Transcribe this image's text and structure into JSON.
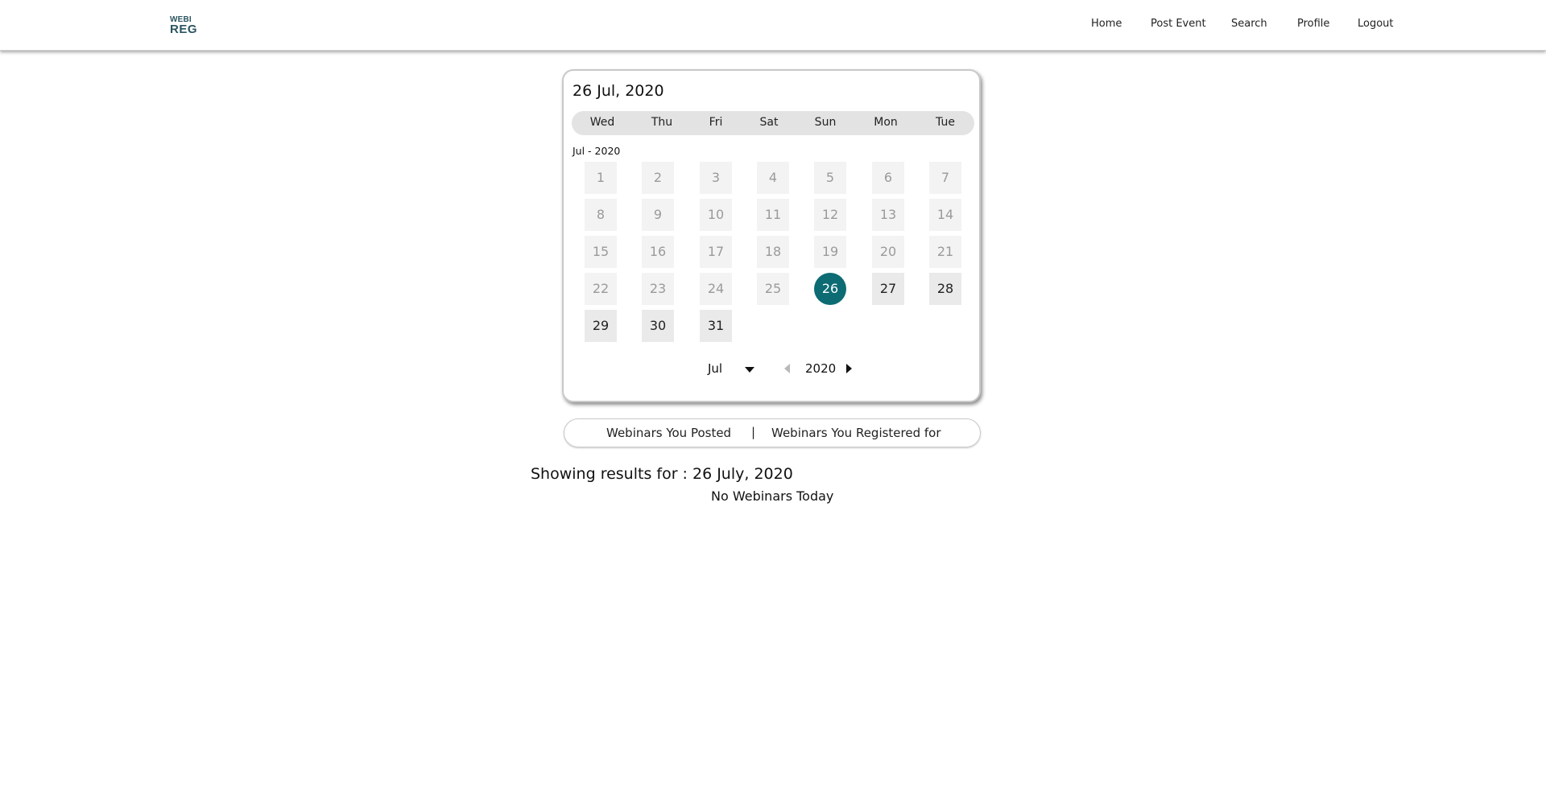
{
  "logo": {
    "line1": "WEBI",
    "line2": "REG"
  },
  "nav": {
    "home": "Home",
    "post_event": "Post Event",
    "search": "Search",
    "profile": "Profile",
    "logout": "Logout"
  },
  "calendar": {
    "selected_date_title": "26 Jul, 2020",
    "weekdays": [
      "Wed",
      "Thu",
      "Fri",
      "Sat",
      "Sun",
      "Mon",
      "Tue"
    ],
    "month_label": "Jul - 2020",
    "days": [
      "1",
      "2",
      "3",
      "4",
      "5",
      "6",
      "7",
      "8",
      "9",
      "10",
      "11",
      "12",
      "13",
      "14",
      "15",
      "16",
      "17",
      "18",
      "19",
      "20",
      "21",
      "22",
      "23",
      "24",
      "25",
      "26",
      "27",
      "28",
      "29",
      "30",
      "31"
    ],
    "selected_day": "26",
    "picker_month": "Jul",
    "picker_year": "2020",
    "selected_color": "#0c6b73"
  },
  "tabs": {
    "posted": "Webinars You Posted",
    "separator": "|",
    "registered": "Webinars You Registered for"
  },
  "results": {
    "heading": "Showing results for : 26 July, 2020",
    "empty_message": "No Webinars Today"
  }
}
